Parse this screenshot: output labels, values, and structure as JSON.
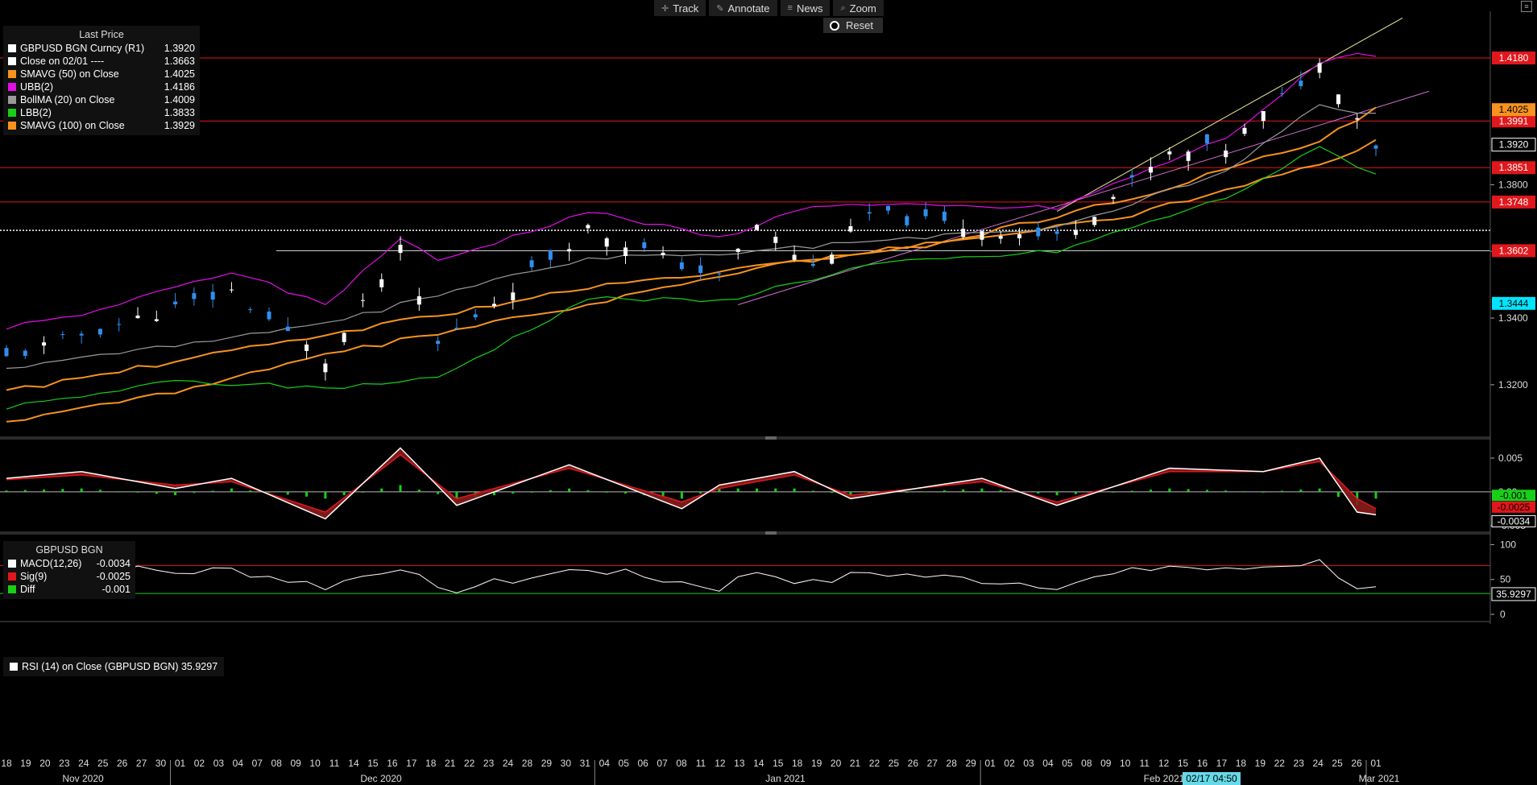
{
  "toolbar": {
    "buttons": [
      {
        "label": "Track",
        "icon": "crosshair-icon"
      },
      {
        "label": "Annotate",
        "icon": "pencil-icon"
      },
      {
        "label": "News",
        "icon": "list-icon"
      },
      {
        "label": "Zoom",
        "icon": "magnifier-icon"
      }
    ],
    "reset_label": "Reset"
  },
  "legend_main": {
    "title": "Last Price",
    "rows": [
      {
        "label": "GBPUSD BGN Curncy  (R1)",
        "value": "1.3920",
        "color": "#ffffff"
      },
      {
        "label": "Close on 02/01 ----",
        "value": "1.3663",
        "color": "#ffffff"
      },
      {
        "label": "SMAVG (50)  on Close",
        "value": "1.4025",
        "color": "#f7931e"
      },
      {
        "label": "UBB(2)",
        "value": "1.4186",
        "color": "#e20ee8"
      },
      {
        "label": "BollMA (20)  on Close",
        "value": "1.4009",
        "color": "#9a9a9a"
      },
      {
        "label": "LBB(2)",
        "value": "1.3833",
        "color": "#17d017"
      },
      {
        "label": "SMAVG (100)  on Close",
        "value": "1.3929",
        "color": "#f7931e"
      }
    ]
  },
  "legend_macd": {
    "title": "GBPUSD BGN",
    "rows": [
      {
        "label": "MACD(12,26)",
        "value": "-0.0034",
        "color": "#ffffff"
      },
      {
        "label": "Sig(9)",
        "value": "-0.0025",
        "color": "#e0171c"
      },
      {
        "label": "Diff",
        "value": "-0.001",
        "color": "#17d017"
      }
    ]
  },
  "legend_rsi": {
    "label": "RSI (14)  on Close (GBPUSD BGN) 35.9297",
    "color": "#ffffff"
  },
  "colors": {
    "price_up": "#ffffff",
    "price_down": "#2f8ff0",
    "sma50": "#f7931e",
    "sma100": "#f7931e",
    "ubb": "#e20ee8",
    "bollma": "#9a9a9a",
    "lbb": "#17d017",
    "hline": "#e0171c",
    "macd": "#ffffff",
    "signal": "#e0171c",
    "diff": "#17d017"
  },
  "chart_data": [
    {
      "type": "candlestick",
      "panel": "price",
      "ylim": [
        1.305,
        1.432
      ],
      "y_ticks": [
        "1.3200",
        "1.3400",
        "1.3600",
        "1.3800"
      ],
      "horizontal_lines": [
        {
          "value": 1.418,
          "label": "1.4180",
          "style": "red"
        },
        {
          "value": 1.3991,
          "label": "1.3991",
          "style": "red"
        },
        {
          "value": 1.3851,
          "label": "1.3851",
          "style": "red"
        },
        {
          "value": 1.3748,
          "label": "1.3748",
          "style": "red"
        },
        {
          "value": 1.3663,
          "label": "",
          "style": "dotted"
        },
        {
          "value": 1.3602,
          "label": "1.3602",
          "style": "white"
        }
      ],
      "right_tags": [
        {
          "value": 1.4025,
          "label": "1.4025",
          "color": "#f7931e"
        },
        {
          "value": 1.392,
          "label": "1.3920",
          "color": "#ffffff"
        },
        {
          "value": 1.3444,
          "label": "1.3444",
          "color": "#00e5ff"
        }
      ],
      "trend_lines": [
        {
          "from": [
            "2021-02-04",
            1.372
          ],
          "to": [
            "2021-03-03",
            1.43
          ],
          "color": "#eeee99"
        },
        {
          "from": [
            "2021-01-12",
            1.344
          ],
          "to": [
            "2021-03-05",
            1.408
          ],
          "color": "#d070d0"
        }
      ],
      "series": [
        {
          "name": "GBPUSD BGN Curncy",
          "x": [
            "2020-11-18",
            "2020-11-24",
            "2020-12-01",
            "2020-12-04",
            "2020-12-11",
            "2020-12-17",
            "2020-12-21",
            "2020-12-31",
            "2021-01-06",
            "2021-01-11",
            "2021-01-13",
            "2021-01-18",
            "2021-01-21",
            "2021-02-04",
            "2021-02-12",
            "2021-02-17",
            "2021-02-24",
            "2021-02-25",
            "2021-03-01"
          ],
          "y": [
            1.328,
            1.335,
            1.343,
            1.348,
            1.327,
            1.36,
            1.332,
            1.367,
            1.358,
            1.352,
            1.368,
            1.355,
            1.371,
            1.364,
            1.389,
            1.391,
            1.416,
            1.409,
            1.392
          ]
        },
        {
          "name": "SMAVG (50)  on Close",
          "x": [
            "2020-11-18",
            "2020-12-01",
            "2020-12-14",
            "2020-12-31",
            "2021-01-14",
            "2021-01-28",
            "2021-02-10",
            "2021-02-24",
            "2021-03-01"
          ],
          "y": [
            1.318,
            1.327,
            1.336,
            1.349,
            1.356,
            1.364,
            1.376,
            1.393,
            1.4025
          ]
        },
        {
          "name": "SMAVG (100)  on Close",
          "x": [
            "2020-11-18",
            "2020-12-01",
            "2020-12-14",
            "2020-12-31",
            "2021-01-14",
            "2021-01-28",
            "2021-02-10",
            "2021-02-24",
            "2021-03-01"
          ],
          "y": [
            1.309,
            1.318,
            1.33,
            1.344,
            1.356,
            1.363,
            1.371,
            1.386,
            1.3929
          ]
        },
        {
          "name": "UBB(2)",
          "x": [
            "2020-11-18",
            "2020-11-24",
            "2020-12-01",
            "2020-12-04",
            "2020-12-11",
            "2020-12-17",
            "2020-12-21",
            "2020-12-31",
            "2021-01-11",
            "2021-01-18",
            "2021-02-04",
            "2021-02-17",
            "2021-02-24",
            "2021-02-26",
            "2021-03-01"
          ],
          "y": [
            1.337,
            1.341,
            1.349,
            1.354,
            1.344,
            1.364,
            1.357,
            1.372,
            1.364,
            1.374,
            1.373,
            1.394,
            1.416,
            1.42,
            1.4186
          ]
        },
        {
          "name": "BollMA (20)  on Close",
          "x": [
            "2020-11-18",
            "2020-12-01",
            "2020-12-11",
            "2020-12-21",
            "2020-12-31",
            "2021-01-11",
            "2021-01-21",
            "2021-02-04",
            "2021-02-17",
            "2021-02-24",
            "2021-03-01"
          ],
          "y": [
            1.325,
            1.332,
            1.338,
            1.347,
            1.358,
            1.359,
            1.363,
            1.367,
            1.384,
            1.404,
            1.4009
          ]
        },
        {
          "name": "LBB(2)",
          "x": [
            "2020-11-18",
            "2020-12-01",
            "2020-12-11",
            "2020-12-21",
            "2020-12-31",
            "2021-01-11",
            "2021-01-21",
            "2021-02-04",
            "2021-02-17",
            "2021-02-24",
            "2021-03-01"
          ],
          "y": [
            1.313,
            1.321,
            1.319,
            1.322,
            1.346,
            1.345,
            1.356,
            1.36,
            1.376,
            1.391,
            1.3833
          ]
        }
      ]
    },
    {
      "type": "line",
      "panel": "macd",
      "ylim": [
        -0.0055,
        0.0075
      ],
      "y_ticks": [
        "0.005",
        "0.00",
        "-0.005"
      ],
      "right_tags": [
        {
          "value": -0.001,
          "label": "-0.001",
          "color": "#17d017"
        },
        {
          "value": -0.0025,
          "label": "-0.0025",
          "color": "#e0171c"
        },
        {
          "value": -0.0034,
          "label": "-0.0034",
          "color": "#ffffff"
        }
      ],
      "series": [
        {
          "name": "MACD(12,26)",
          "x": [
            "2020-11-18",
            "2020-11-24",
            "2020-12-01",
            "2020-12-04",
            "2020-12-11",
            "2020-12-17",
            "2020-12-22",
            "2020-12-30",
            "2021-01-07",
            "2021-01-11",
            "2021-01-15",
            "2021-01-20",
            "2021-01-29",
            "2021-02-04",
            "2021-02-12",
            "2021-02-19",
            "2021-02-24",
            "2021-02-26",
            "2021-03-01"
          ],
          "y": [
            0.002,
            0.003,
            0.0005,
            0.002,
            -0.004,
            0.0065,
            -0.002,
            0.004,
            -0.0025,
            0.001,
            0.003,
            -0.001,
            0.002,
            -0.002,
            0.0035,
            0.003,
            0.005,
            -0.003,
            -0.0034
          ]
        },
        {
          "name": "Sig(9)",
          "x": [
            "2020-11-18",
            "2020-11-24",
            "2020-12-01",
            "2020-12-04",
            "2020-12-11",
            "2020-12-17",
            "2020-12-22",
            "2020-12-30",
            "2021-01-07",
            "2021-01-11",
            "2021-01-15",
            "2021-01-20",
            "2021-01-29",
            "2021-02-04",
            "2021-02-12",
            "2021-02-19",
            "2021-02-24",
            "2021-02-26",
            "2021-03-01"
          ],
          "y": [
            0.0018,
            0.0025,
            0.001,
            0.0015,
            -0.003,
            0.0055,
            -0.001,
            0.0035,
            -0.0015,
            0.0005,
            0.0025,
            -0.0005,
            0.0015,
            -0.0015,
            0.003,
            0.003,
            0.0045,
            -0.001,
            -0.0025
          ]
        },
        {
          "name": "Diff",
          "x": [
            "2020-11-18",
            "2020-11-24",
            "2020-12-01",
            "2020-12-04",
            "2020-12-11",
            "2020-12-17",
            "2020-12-22",
            "2020-12-30",
            "2021-01-07",
            "2021-01-11",
            "2021-01-15",
            "2021-01-20",
            "2021-01-29",
            "2021-02-04",
            "2021-02-12",
            "2021-02-19",
            "2021-02-24",
            "2021-02-26",
            "2021-03-01"
          ],
          "y": [
            0.0002,
            0.0005,
            -0.0005,
            0.0005,
            -0.001,
            0.001,
            -0.001,
            0.0005,
            -0.001,
            0.0005,
            0.0005,
            -0.0005,
            0.0005,
            -0.0005,
            0.0005,
            0.0,
            0.0005,
            -0.002,
            -0.001
          ]
        }
      ]
    },
    {
      "type": "line",
      "panel": "rsi",
      "ylim": [
        0,
        100
      ],
      "y_ticks": [
        "100",
        "50",
        "0"
      ],
      "horizontal_lines": [
        {
          "value": 70,
          "color": "#e0171c"
        },
        {
          "value": 30,
          "color": "#17d017"
        }
      ],
      "right_tags": [
        {
          "value": 35.9297,
          "label": "35.9297",
          "color": "#ffffff"
        }
      ],
      "series": [
        {
          "name": "RSI (14)  on Close (GBPUSD BGN)",
          "x": [
            "2020-11-18",
            "2020-11-23",
            "2020-12-01",
            "2020-12-04",
            "2020-12-11",
            "2020-12-17",
            "2020-12-21",
            "2020-12-31",
            "2021-01-06",
            "2021-01-11",
            "2021-01-13",
            "2021-01-18",
            "2021-01-21",
            "2021-02-04",
            "2021-02-12",
            "2021-02-17",
            "2021-02-22",
            "2021-02-24",
            "2021-02-26",
            "2021-03-01"
          ],
          "y": [
            56,
            72,
            60,
            64,
            40,
            70,
            32,
            66,
            50,
            38,
            62,
            44,
            60,
            42,
            70,
            62,
            72,
            75,
            40,
            35.9297
          ]
        }
      ]
    }
  ],
  "x_axis": {
    "day_labels": [
      "18",
      "19",
      "20",
      "23",
      "24",
      "25",
      "26",
      "27",
      "30",
      "01",
      "02",
      "03",
      "04",
      "07",
      "08",
      "09",
      "10",
      "11",
      "14",
      "15",
      "16",
      "17",
      "18",
      "21",
      "22",
      "23",
      "24",
      "28",
      "29",
      "30",
      "31",
      "04",
      "05",
      "06",
      "07",
      "08",
      "11",
      "12",
      "13",
      "14",
      "15",
      "18",
      "19",
      "20",
      "21",
      "22",
      "25",
      "26",
      "27",
      "28",
      "29",
      "01",
      "02",
      "03",
      "04",
      "05",
      "08",
      "09",
      "10",
      "11",
      "12",
      "15",
      "16",
      "17",
      "18",
      "19",
      "22",
      "23",
      "24",
      "25",
      "26",
      "01"
    ],
    "month_labels": [
      "Nov 2020",
      "Dec 2020",
      "Jan 2021",
      "Feb 2021",
      "Mar 2021"
    ],
    "cursor_label": "02/17 04:50"
  }
}
